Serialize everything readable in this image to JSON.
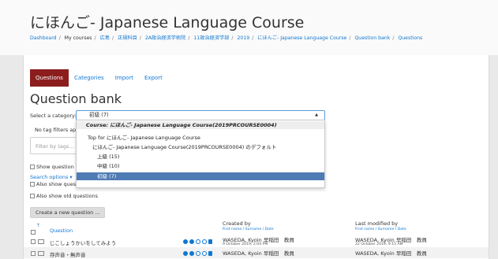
{
  "header": {
    "course_title": "にほんご- Japanese Language Course",
    "breadcrumb": [
      "Dashboard",
      "My courses",
      "広島",
      "正規科目",
      "2A政治経済学術院",
      "11政治経済学部",
      "2019",
      "にほんご- Japanese Language Course",
      "Question bank",
      "Questions"
    ]
  },
  "tabs": [
    {
      "label": "Questions",
      "active": true
    },
    {
      "label": "Categories",
      "active": false
    },
    {
      "label": "Import",
      "active": false
    },
    {
      "label": "Export",
      "active": false
    }
  ],
  "page_title": "Question bank",
  "category": {
    "label": "Select a category:",
    "selected": "初級 (7)",
    "options": [
      {
        "label": "Course: にほんご- Japanese Language Course(2019PRCOURSE0004)",
        "type": "group"
      },
      {
        "label": "Top for にほんご- Japanese Language Course",
        "indent": 1
      },
      {
        "label": "にほんご- Japanese Language Course(2019PRCOURSE0004) のデフォルト",
        "indent": 2
      },
      {
        "label": "上級 (15)",
        "indent": 3
      },
      {
        "label": "中級 (10)",
        "indent": 3
      },
      {
        "label": "初級 (7)",
        "indent": 3,
        "selected": true
      }
    ]
  },
  "filters": {
    "no_tag_label": "No tag filters ap",
    "tag_placeholder": "Filter by tags...",
    "show_question_label": "Show question",
    "search_options_label": "Search options",
    "subcategories_label": "Also show questions from subcategories",
    "old_questions_label": "Also show old questions"
  },
  "create_button_label": "Create a new question ...",
  "table": {
    "question_header": "Question",
    "created_by_header": "Created by",
    "created_sub": "First name / Surname / Date",
    "modified_header": "Last modified by",
    "modified_sub": "First name / Surname / Date",
    "rows": [
      {
        "name": "じこしょうかいをしてみよう",
        "created_by": "WASEDA, Kyoin 早稲田　教員",
        "created_date": "9 October 2019, 2:04 PM",
        "modified_by": "WASEDA, Kyoin 早稲田　教員",
        "modified_date": "22 October 2019, 9:15 AM"
      },
      {
        "name": "存声音・無声音",
        "created_by": "WASEDA, Kyoin 早稲田　教員",
        "created_date": "",
        "modified_by": "WASEDA, Kyoin 早稲田　教員",
        "modified_date": ""
      }
    ]
  }
}
